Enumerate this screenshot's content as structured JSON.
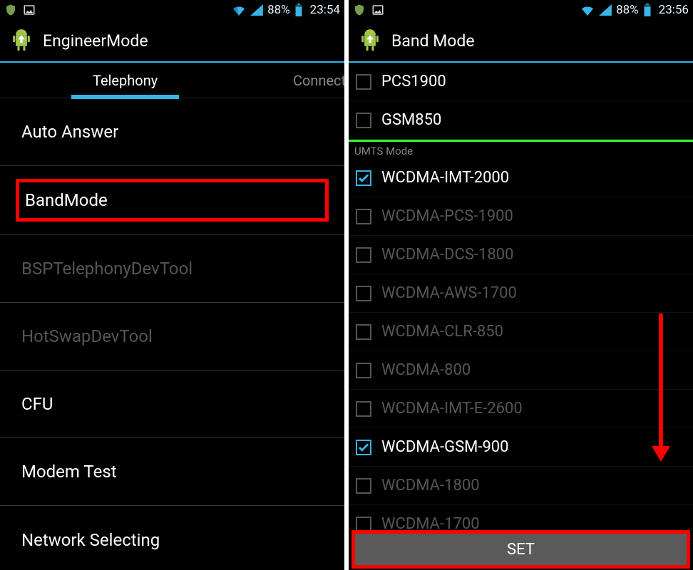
{
  "screen1": {
    "status": {
      "battery": "88%",
      "time": "23:54"
    },
    "title": "EngineerMode",
    "tabs": {
      "active": "Telephony",
      "next": "Connect"
    },
    "items": [
      {
        "label": "Auto Answer",
        "dimmed": false
      },
      {
        "label": "BandMode",
        "highlighted": true
      },
      {
        "label": "BSPTelephonyDevTool",
        "dimmed": true
      },
      {
        "label": "HotSwapDevTool",
        "dimmed": true
      },
      {
        "label": "CFU",
        "dimmed": false
      },
      {
        "label": "Modem Test",
        "dimmed": false
      },
      {
        "label": "Network Selecting",
        "dimmed": false
      }
    ]
  },
  "screen2": {
    "status": {
      "battery": "88%",
      "time": "23:56"
    },
    "title": "Band Mode",
    "top_items": [
      {
        "label": "PCS1900",
        "checked": false,
        "enabled": true
      },
      {
        "label": "GSM850",
        "checked": false,
        "enabled": true
      }
    ],
    "section": "UMTS Mode",
    "umts_items": [
      {
        "label": "WCDMA-IMT-2000",
        "checked": true,
        "enabled": true
      },
      {
        "label": "WCDMA-PCS-1900",
        "checked": false,
        "enabled": false
      },
      {
        "label": "WCDMA-DCS-1800",
        "checked": false,
        "enabled": false
      },
      {
        "label": "WCDMA-AWS-1700",
        "checked": false,
        "enabled": false
      },
      {
        "label": "WCDMA-CLR-850",
        "checked": false,
        "enabled": false
      },
      {
        "label": "WCDMA-800",
        "checked": false,
        "enabled": false
      },
      {
        "label": "WCDMA-IMT-E-2600",
        "checked": false,
        "enabled": false
      },
      {
        "label": "WCDMA-GSM-900",
        "checked": true,
        "enabled": true
      },
      {
        "label": "WCDMA-1800",
        "checked": false,
        "enabled": false
      },
      {
        "label": "WCDMA-1700",
        "checked": false,
        "enabled": false
      }
    ],
    "button": "SET"
  }
}
